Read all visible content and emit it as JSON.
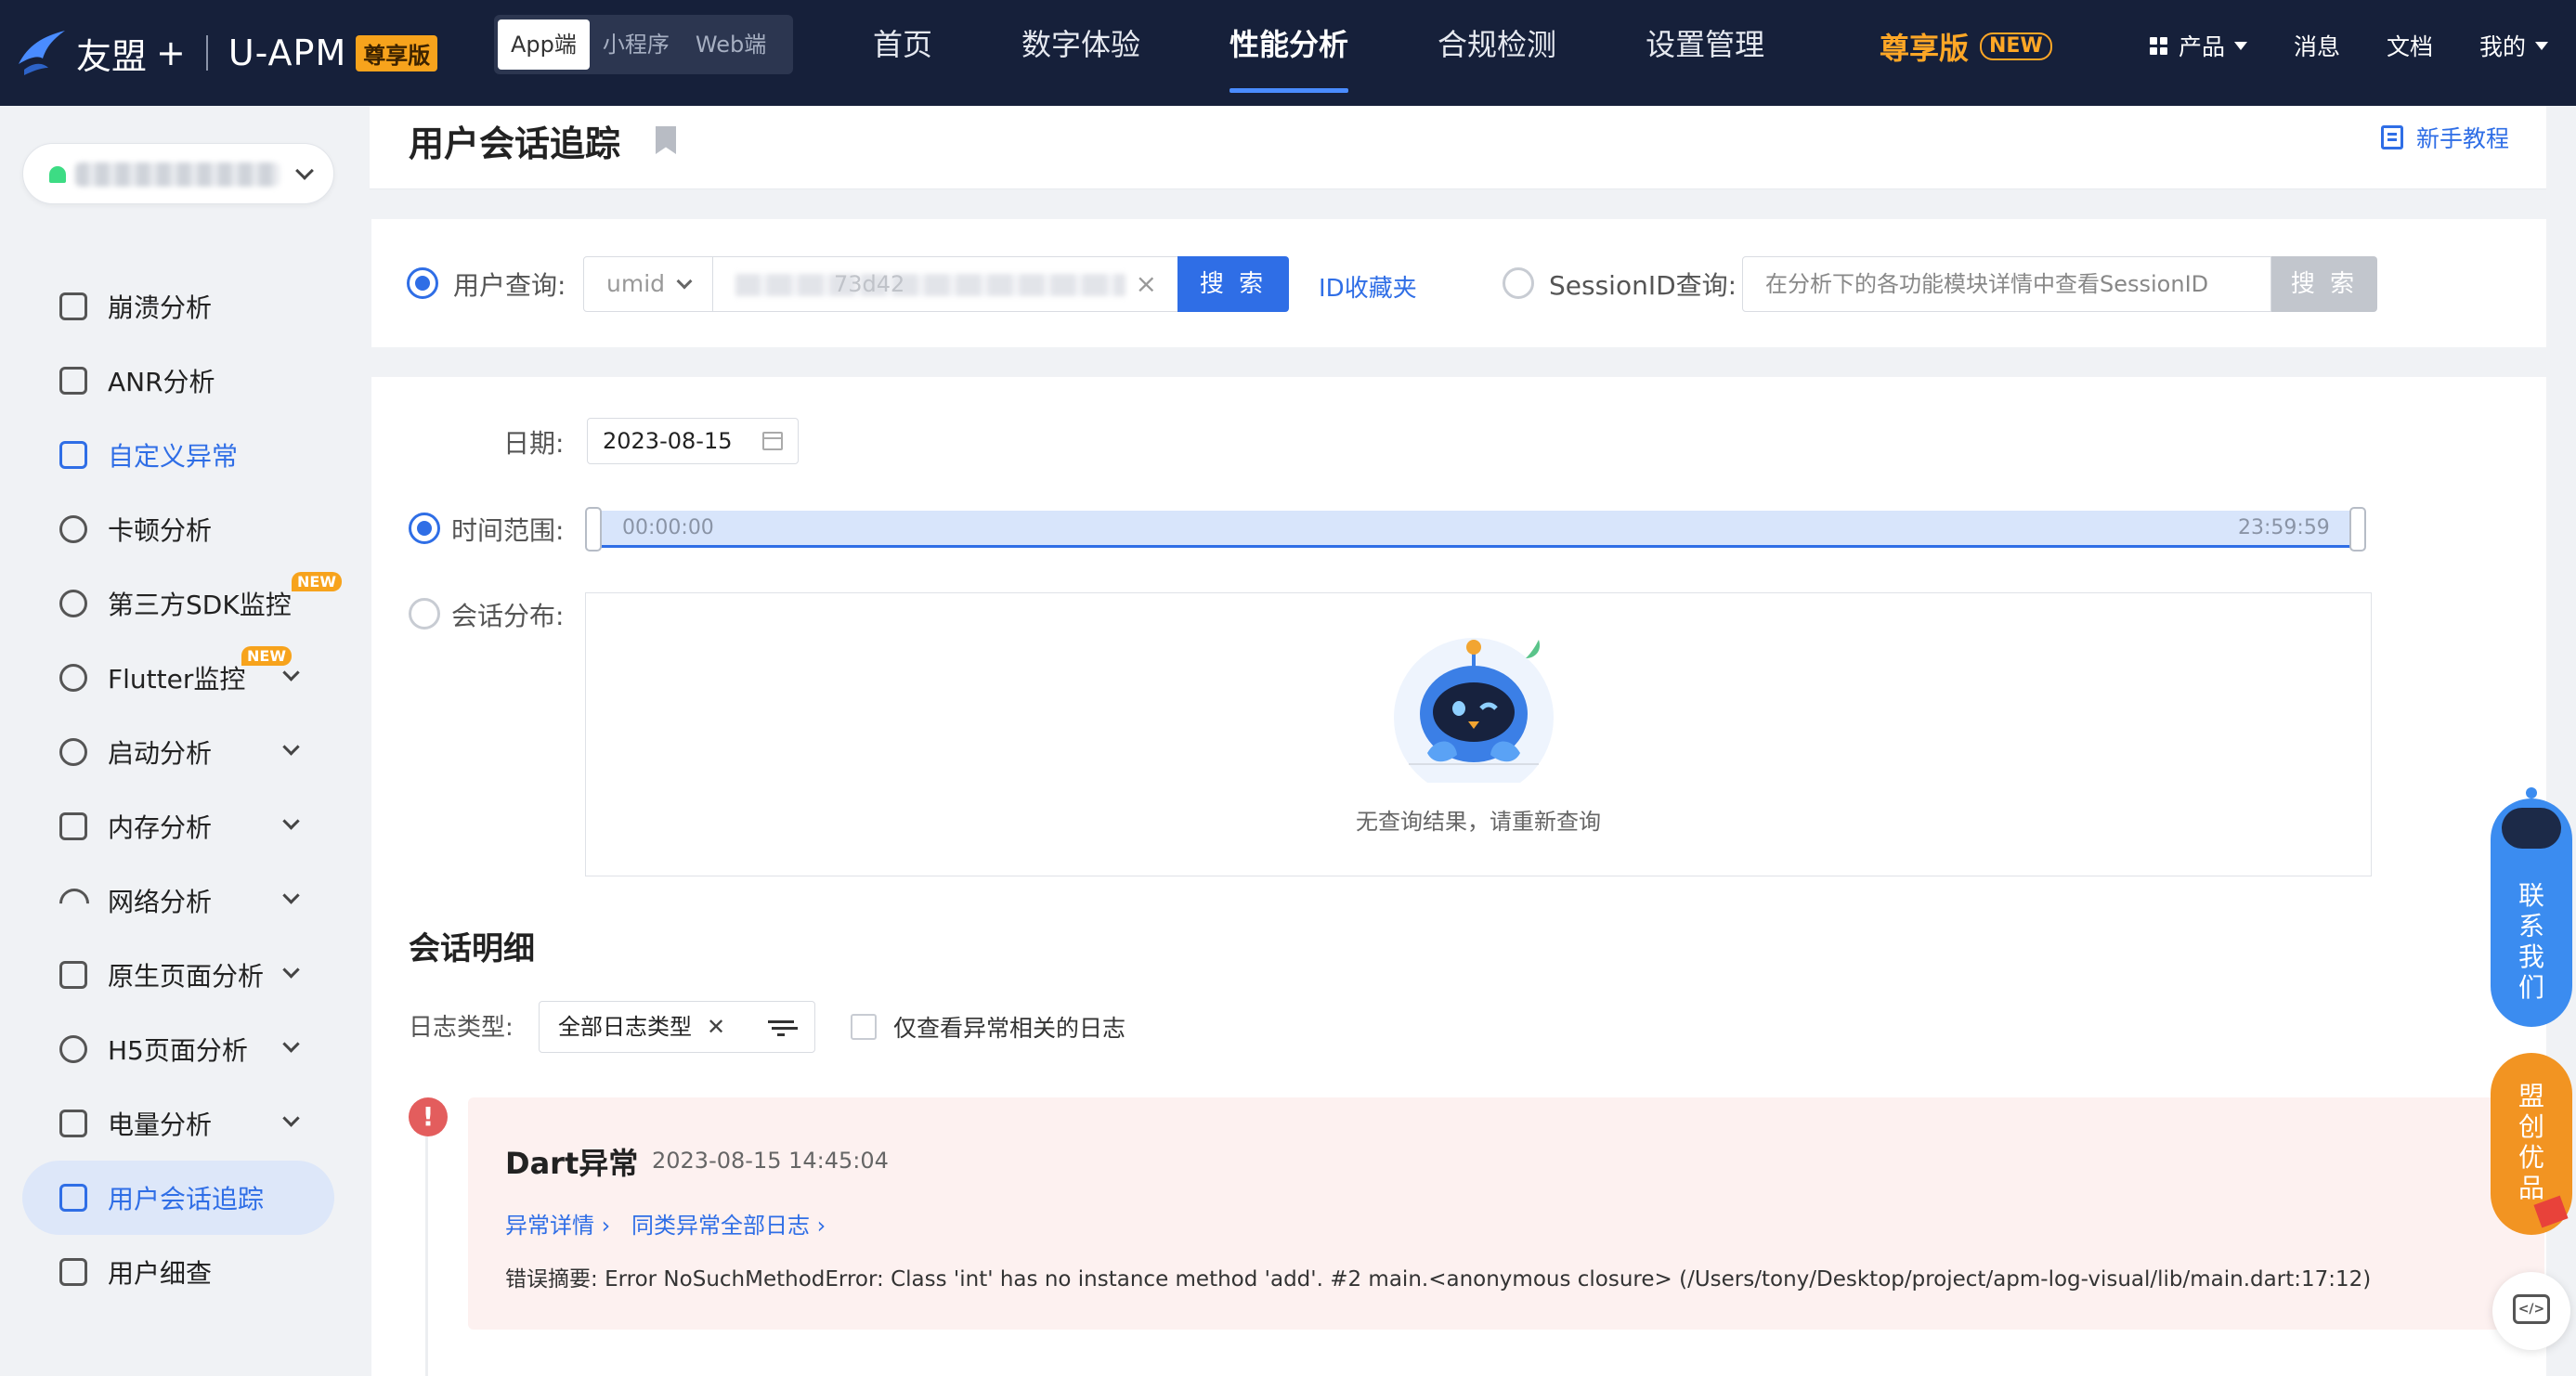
{
  "header": {
    "brand": "友盟",
    "brand_plus": "+",
    "product": "U-APM",
    "edition_badge": "尊享版",
    "platforms": [
      {
        "label": "App端",
        "active": true
      },
      {
        "label": "小程序",
        "active": false
      },
      {
        "label": "Web端",
        "active": false
      }
    ],
    "nav": [
      {
        "label": "首页",
        "active": false
      },
      {
        "label": "数字体验",
        "active": false
      },
      {
        "label": "性能分析",
        "active": true
      },
      {
        "label": "合规检测",
        "active": false
      },
      {
        "label": "设置管理",
        "active": false
      }
    ],
    "premium": {
      "label": "尊享版",
      "badge": "NEW"
    },
    "right": {
      "products": "产品",
      "messages": "消息",
      "docs": "文档",
      "me": "我的"
    },
    "colors": {
      "bg": "#16203a",
      "accent": "#4a8cff",
      "premium": "#ffa726"
    }
  },
  "sidebar": {
    "app_selector": {
      "icon": "android-icon"
    },
    "items": [
      {
        "label": "崩溃分析",
        "icon": "crash-icon",
        "expandable": false
      },
      {
        "label": "ANR分析",
        "icon": "anr-icon",
        "expandable": false
      },
      {
        "label": "自定义异常",
        "icon": "chart-icon",
        "expandable": false,
        "highlight": true
      },
      {
        "label": "卡顿分析",
        "icon": "clock-icon",
        "expandable": false
      },
      {
        "label": "第三方SDK监控",
        "icon": "sdk-icon",
        "expandable": false,
        "badge": "NEW"
      },
      {
        "label": "Flutter监控",
        "icon": "gauge-icon",
        "expandable": true,
        "badge": "NEW"
      },
      {
        "label": "启动分析",
        "icon": "power-icon",
        "expandable": true
      },
      {
        "label": "内存分析",
        "icon": "save-icon",
        "expandable": true
      },
      {
        "label": "网络分析",
        "icon": "wifi-icon",
        "expandable": true
      },
      {
        "label": "原生页面分析",
        "icon": "page-icon",
        "expandable": true
      },
      {
        "label": "H5页面分析",
        "icon": "h5-icon",
        "expandable": true
      },
      {
        "label": "电量分析",
        "icon": "battery-icon",
        "expandable": true
      },
      {
        "label": "用户会话追踪",
        "icon": "session-icon",
        "expandable": false,
        "active": true
      },
      {
        "label": "用户细查",
        "icon": "user-icon",
        "expandable": false
      }
    ]
  },
  "page": {
    "title": "用户会话追踪",
    "tutorial": "新手教程"
  },
  "query": {
    "user_label": "用户查询:",
    "id_type": "umid",
    "id_value_partial": "73d42",
    "search": "搜 索",
    "favorites": "ID收藏夹",
    "session_label": "SessionID查询:",
    "session_placeholder": "在分析下的各功能模块详情中查看SessionID",
    "session_search": "搜 索"
  },
  "filters": {
    "date_label": "日期:",
    "date_value": "2023-08-15",
    "range_label": "时间范围:",
    "range_start": "00:00:00",
    "range_end": "23:59:59",
    "distribution_label": "会话分布:",
    "empty_text": "无查询结果，请重新查询"
  },
  "details": {
    "title": "会话明细",
    "log_type_label": "日志类型:",
    "log_type_value": "全部日志类型",
    "only_error_label": "仅查看异常相关的日志",
    "entries": [
      {
        "type": "Dart异常",
        "time": "2023-08-15 14:45:04",
        "link_detail": "异常详情 ›",
        "link_all": "同类异常全部日志 ›",
        "summary_label": "错误摘要:",
        "summary": "Error NoSuchMethodError: Class 'int' has no instance method 'add'. #2 main.<anonymous closure> (/Users/tony/Desktop/project/apm-log-visual/lib/main.dart:17:12)"
      }
    ]
  },
  "floating": {
    "contact": "联系我们",
    "promo": "盟创优品"
  }
}
